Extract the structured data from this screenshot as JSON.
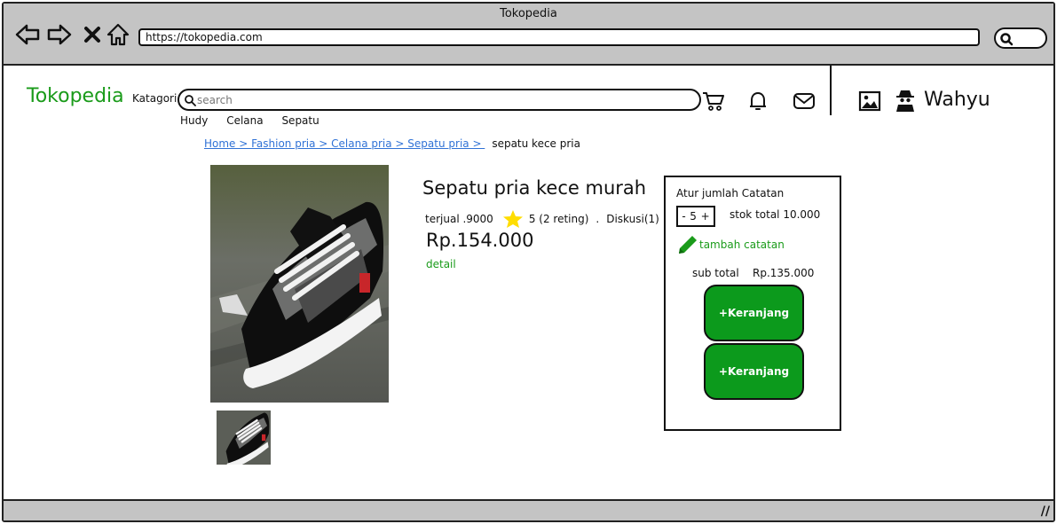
{
  "window": {
    "title": "Tokopedia"
  },
  "address_bar": {
    "url": "https://tokopedia.com"
  },
  "header": {
    "logo": "Tokopedia",
    "category_label": "Katagori",
    "search_placeholder": "search",
    "username": "Wahyu",
    "quick_links": [
      "Hudy",
      "Celana",
      "Sepatu"
    ]
  },
  "breadcrumb": {
    "links": "Home > Fashion pria > Celana pria > Sepatu pria > ",
    "current": "sepatu kece pria"
  },
  "product": {
    "title": "Sepatu pria kece murah",
    "sold": "terjual .9000",
    "rating": "5 (2 reting)",
    "separator": ".",
    "discussion": "Diskusi(1)",
    "price": "Rp.154.000",
    "detail_label": "detail"
  },
  "order": {
    "title": "Atur jumlah Catatan",
    "minus": "-",
    "quantity": "5",
    "plus": "+",
    "stock": "stok total  10.000",
    "add_note": "tambah catatan",
    "subtotal": "sub total    Rp.135.000",
    "cart_button_1": "+Keranjang",
    "cart_button_2": "+Keranjang"
  },
  "colors": {
    "brand_green": "#1a9b1a",
    "button_green": "#0c9a1c",
    "link_blue": "#3072d6",
    "star_yellow": "#ffdd00"
  },
  "icons": [
    "back-icon",
    "forward-icon",
    "close-icon",
    "home-icon",
    "search-icon",
    "cart-icon",
    "bell-icon",
    "mail-icon",
    "image-icon",
    "user-icon",
    "star-icon",
    "pencil-icon"
  ]
}
